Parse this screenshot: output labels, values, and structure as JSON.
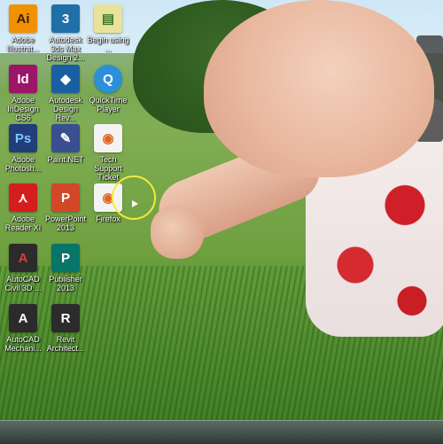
{
  "desktop": {
    "icons": [
      {
        "label": "Adobe Illustrat...",
        "glyph": "Ai",
        "color": "#f29100",
        "text_color": "#3b1d00"
      },
      {
        "label": "Autodesk 3ds Max Design 2...",
        "glyph": "3",
        "color": "#1f6fa8",
        "text_color": "#ffffff"
      },
      {
        "label": "Begin using ...",
        "glyph": "▤",
        "color": "#e9e29a",
        "text_color": "#3c7a2c"
      },
      {
        "label": "Adobe InDesign CS6",
        "glyph": "Id",
        "color": "#9b1569",
        "text_color": "#ffffff"
      },
      {
        "label": "Autodesk Design Rev...",
        "glyph": "◆",
        "color": "#1b5fa3",
        "text_color": "#ffffff"
      },
      {
        "label": "QuickTime Player",
        "glyph": "Q",
        "color": "#2b90d9",
        "text_color": "#ffffff"
      },
      {
        "label": "Adobe Photosh...",
        "glyph": "Ps",
        "color": "#1f3e7a",
        "text_color": "#7fc7ff"
      },
      {
        "label": "Paint.NET",
        "glyph": "✎",
        "color": "#3a4f8f",
        "text_color": "#ffffff"
      },
      {
        "label": "Tech Support Ticket",
        "glyph": "◉",
        "color": "#f3f3f3",
        "text_color": "#e0661c"
      },
      {
        "label": "Adobe Reader XI",
        "glyph": "⋏",
        "color": "#d61d1d",
        "text_color": "#ffffff"
      },
      {
        "label": "PowerPoint 2013",
        "glyph": "P",
        "color": "#d24726",
        "text_color": "#ffffff"
      },
      {
        "label": "Firefox",
        "glyph": "◉",
        "color": "#f3f3f3",
        "text_color": "#e0661c"
      },
      {
        "label": "AutoCAD Civil 3D ...",
        "glyph": "A",
        "color": "#2b2b2b",
        "text_color": "#e23b3b"
      },
      {
        "label": "Publisher 2013",
        "glyph": "P",
        "color": "#077568",
        "text_color": "#ffffff"
      },
      {
        "label": "AutoCAD Mechani...",
        "glyph": "A",
        "color": "#2b2b2b",
        "text_color": "#f2f2f2"
      },
      {
        "label": "Revit Architect...",
        "glyph": "R",
        "color": "#2b2b2b",
        "text_color": "#f2f2f2"
      }
    ]
  },
  "colors": {
    "cursor_highlight": "#f4e93a",
    "taskbar": "#2e3a36"
  }
}
